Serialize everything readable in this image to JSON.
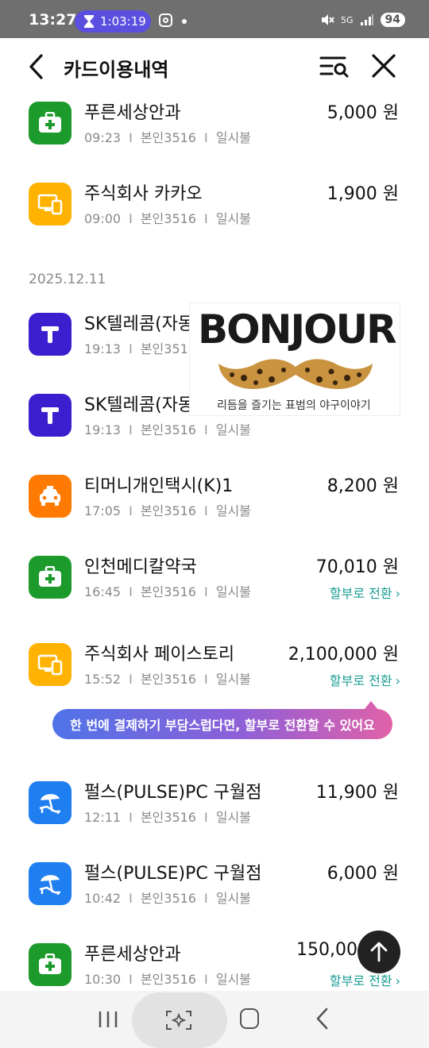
{
  "status_bar": {
    "time": "13:27",
    "timer": "1:03:19",
    "battery": "94",
    "network": "5G"
  },
  "header": {
    "title": "카드이용내역"
  },
  "top_transactions": [
    {
      "merchant": "푸른세상안과",
      "time": "09:23",
      "card": "본인3516",
      "payment": "일시불",
      "amount": "5,000 원",
      "icon": "hospital-icon",
      "color": "#1d9a2c"
    },
    {
      "merchant": "주식회사 카카오",
      "time": "09:00",
      "card": "본인3516",
      "payment": "일시불",
      "amount": "1,900 원",
      "icon": "device-icon",
      "color": "#ffb300"
    }
  ],
  "date_group": "2025.12.11",
  "transactions": [
    {
      "merchant": "SK텔레콤(자동",
      "time": "19:13",
      "card": "본인351",
      "payment": "",
      "amount": "",
      "icon": "telecom-icon",
      "color": "#3b1fcf"
    },
    {
      "merchant": "SK텔레콤(자동",
      "time": "19:13",
      "card": "본인3516",
      "payment": "일시불",
      "amount": "",
      "icon": "telecom-icon",
      "color": "#3b1fcf"
    },
    {
      "merchant": "티머니개인택시(K)1",
      "time": "17:05",
      "card": "본인3516",
      "payment": "일시불",
      "amount": "8,200 원",
      "icon": "taxi-icon",
      "color": "#ff7a00"
    },
    {
      "merchant": "인천메디칼약국",
      "time": "16:45",
      "card": "본인3516",
      "payment": "일시불",
      "amount": "70,010 원",
      "convert": "할부로 전환",
      "icon": "hospital-icon",
      "color": "#1d9a2c"
    },
    {
      "merchant": "주식회사 페이스토리",
      "time": "15:52",
      "card": "본인3516",
      "payment": "일시불",
      "amount": "2,100,000 원",
      "convert": "할부로 전환",
      "icon": "device-icon",
      "color": "#ffb300"
    },
    {
      "merchant": "펄스(PULSE)PC 구월점",
      "time": "12:11",
      "card": "본인3516",
      "payment": "일시불",
      "amount": "11,900 원",
      "icon": "leisure-icon",
      "color": "#1f7ef0"
    },
    {
      "merchant": "펄스(PULSE)PC 구월점",
      "time": "10:42",
      "card": "본인3516",
      "payment": "일시불",
      "amount": "6,000 원",
      "icon": "leisure-icon",
      "color": "#1f7ef0"
    },
    {
      "merchant": "푸른세상안과",
      "time": "10:30",
      "card": "본인3516",
      "payment": "일시불",
      "amount": "150,00",
      "convert": "할부로 전환",
      "icon": "hospital-icon",
      "color": "#1d9a2c"
    }
  ],
  "tooltip": "한 번에 결제하기 부담스럽다면, 할부로 전환할 수 있어요",
  "ad": {
    "brand": "BONJOUR",
    "tagline": "리듬을 즐기는 표범의 야구이야기"
  }
}
